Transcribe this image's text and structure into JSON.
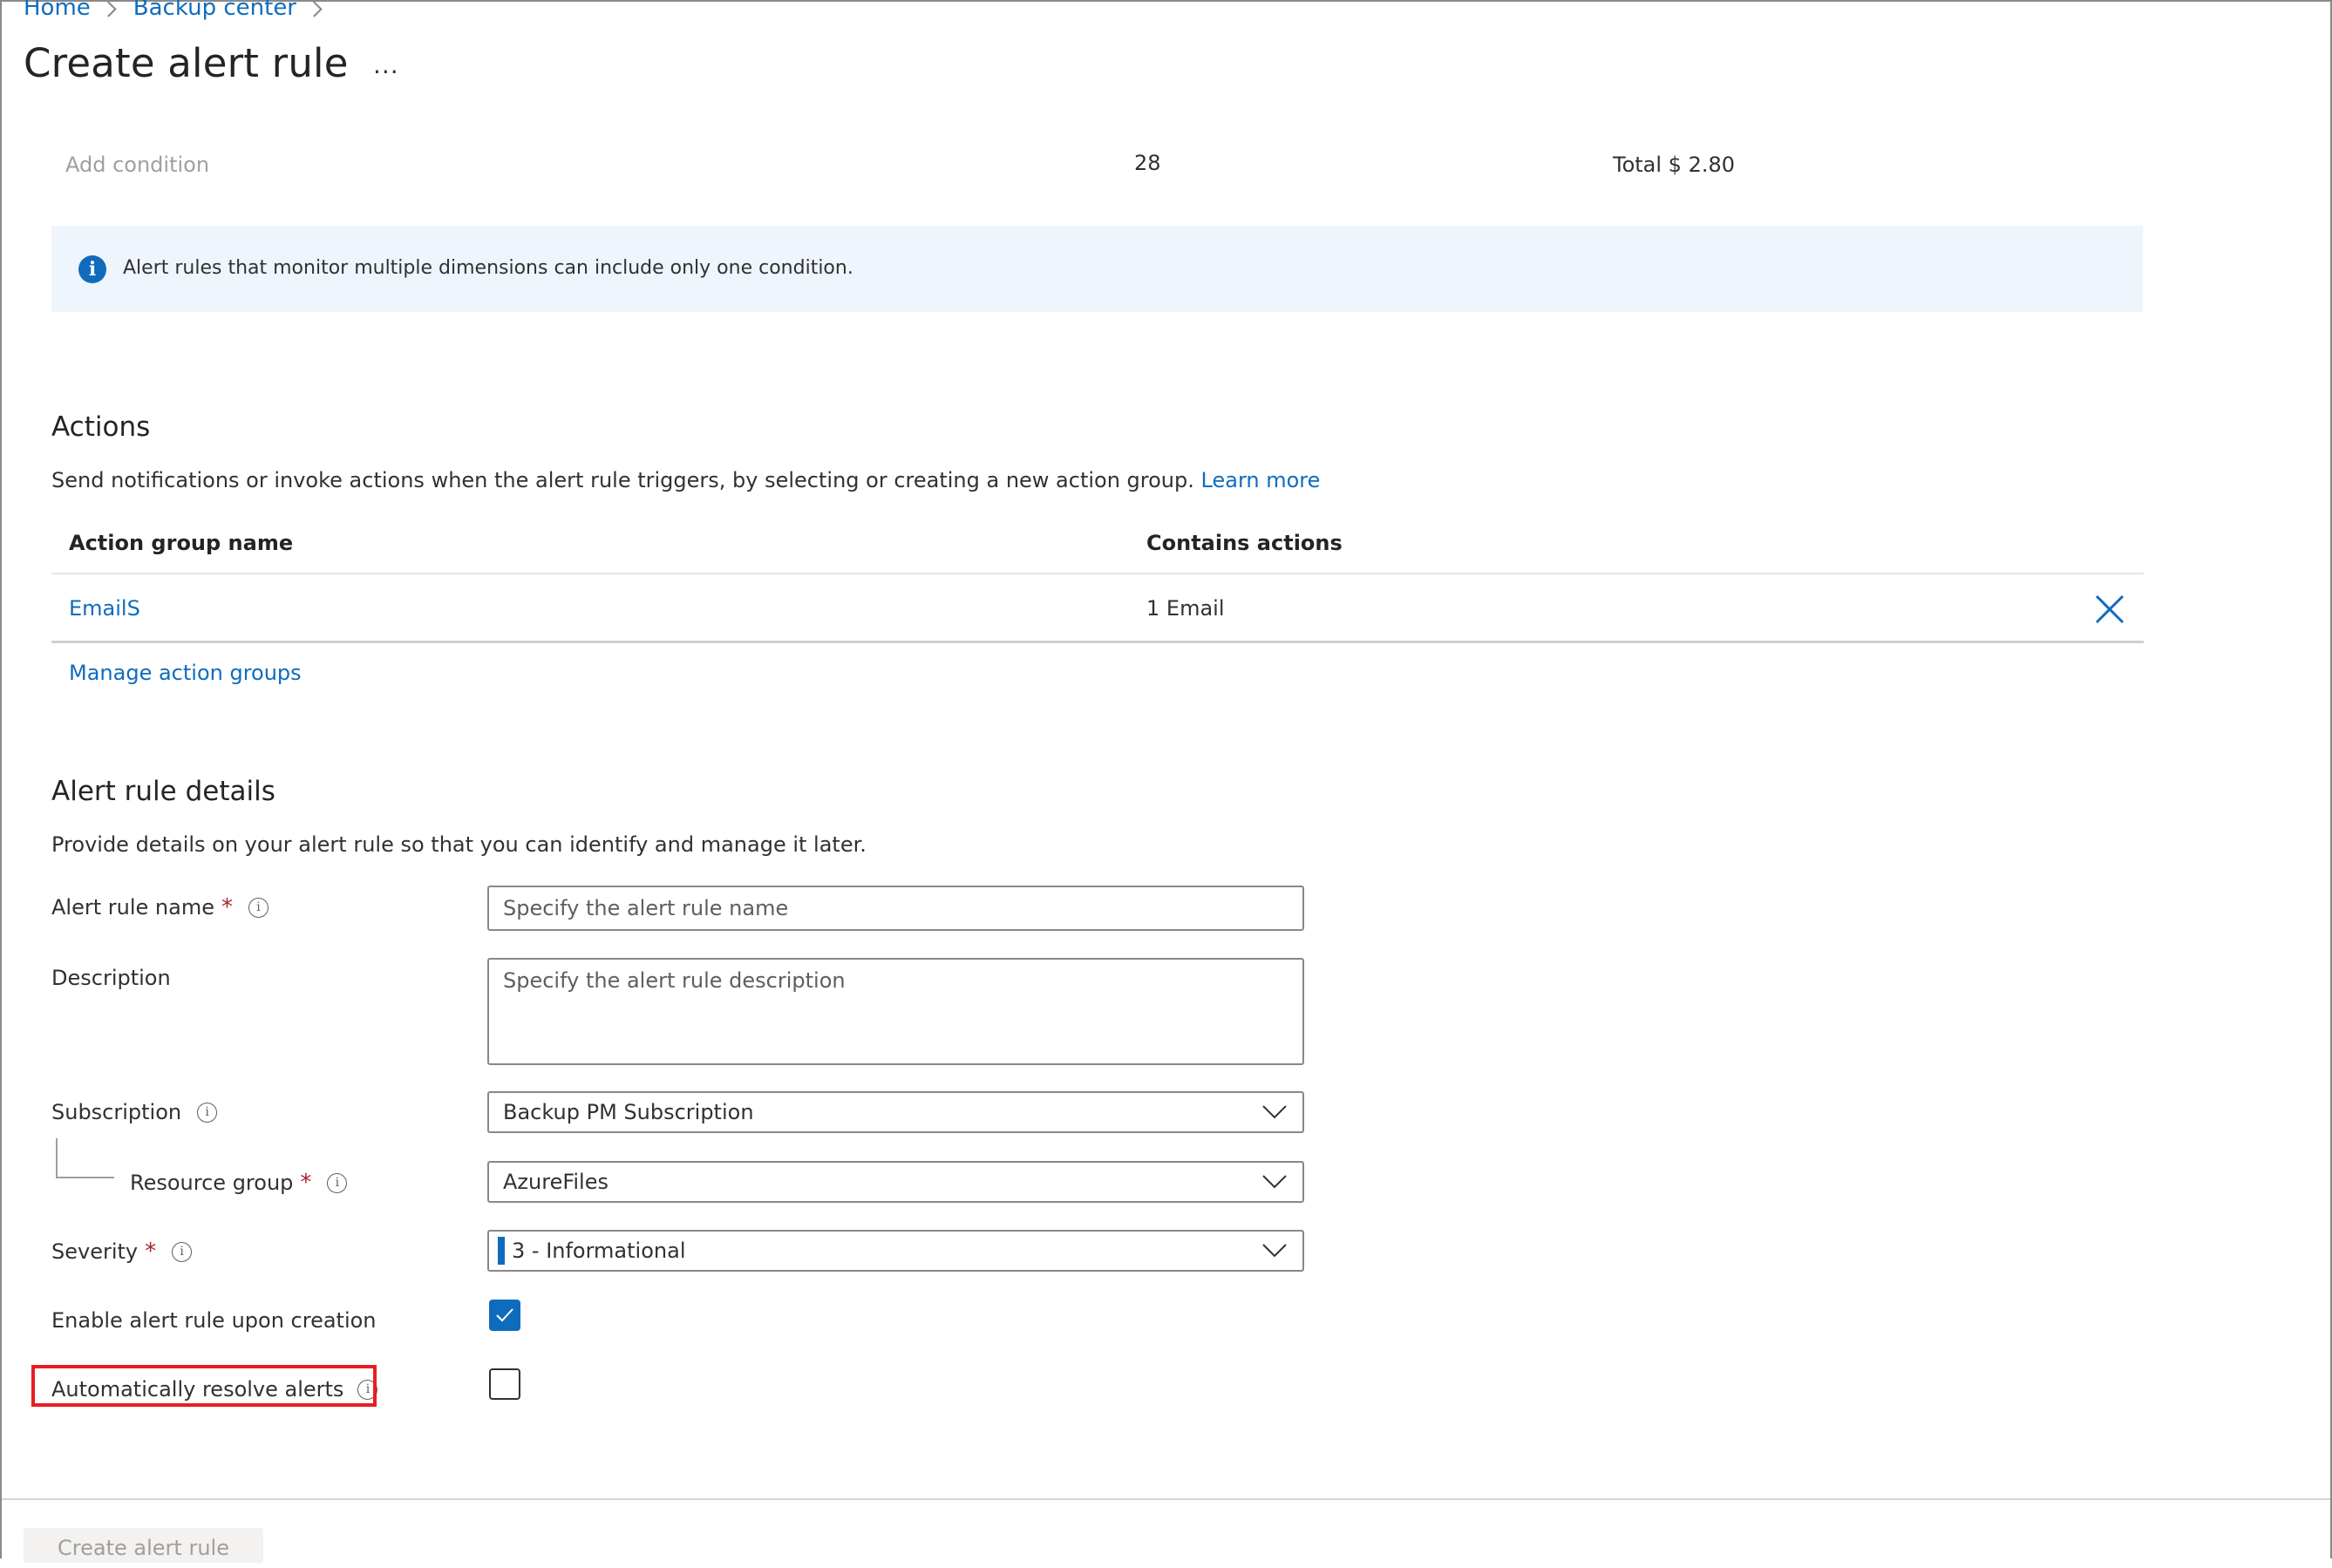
{
  "breadcrumb": [
    {
      "label": "Home"
    },
    {
      "label": "Backup center"
    }
  ],
  "page": {
    "title": "Create alert rule",
    "more_label": "..."
  },
  "conditions": {
    "add_condition_label": "Add condition",
    "count": "28",
    "total": "Total $ 2.80"
  },
  "info_bar": {
    "icon": "info-icon",
    "message": "Alert rules that monitor multiple dimensions can include only one condition."
  },
  "actions": {
    "title": "Actions",
    "description": "Send notifications or invoke actions when the alert rule triggers, by selecting or creating a new action group.",
    "learn_more": "Learn more",
    "columns": [
      "Action group name",
      "Contains actions"
    ],
    "rows": [
      {
        "name": "EmailS",
        "contains": "1 Email"
      }
    ],
    "manage_link": "Manage action groups"
  },
  "details": {
    "title": "Alert rule details",
    "description": "Provide details on your alert rule so that you can identify and manage it later.",
    "fields": {
      "name": {
        "label": "Alert rule name",
        "required": "*",
        "value": "",
        "placeholder": "Specify the alert rule name"
      },
      "description": {
        "label": "Description",
        "value": "",
        "placeholder": "Specify the alert rule description"
      },
      "subscription": {
        "label": "Subscription",
        "value": "Backup PM Subscription"
      },
      "resource_group": {
        "label": "Resource group",
        "required": "*",
        "value": "AzureFiles"
      },
      "severity": {
        "label": "Severity",
        "required": "*",
        "value": "3 - Informational",
        "color": "#0f6cbd"
      },
      "enable_on_creation": {
        "label": "Enable alert rule upon creation",
        "checked": true
      },
      "auto_resolve": {
        "label": "Automatically resolve alerts",
        "checked": false
      }
    }
  },
  "footer": {
    "create_button": "Create alert rule"
  },
  "colors": {
    "accent": "#0f6cbd",
    "required": "#a4262c",
    "highlight": "#e81c24",
    "info_bg": "#eef5fd"
  }
}
